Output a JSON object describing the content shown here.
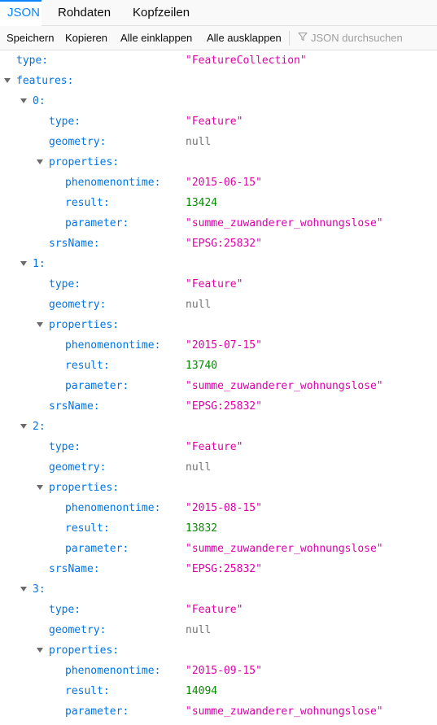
{
  "tabs": {
    "json": "JSON",
    "raw": "Rohdaten",
    "headers": "Kopfzeilen"
  },
  "toolbar": {
    "save": "Speichern",
    "copy": "Kopieren",
    "collapse_all": "Alle einklappen",
    "expand_all": "Alle ausklappen",
    "filter_placeholder": "JSON durchsuchen"
  },
  "colors": {
    "accent": "#0a84ff",
    "key": "#0074e8",
    "string": "#dd00a9",
    "number": "#058b00",
    "null": "#737373"
  },
  "icons": {
    "filter": "filter-icon",
    "expand": "chevron-down-icon"
  },
  "tree": [
    {
      "depth": 0,
      "key": "type:",
      "value": "\"FeatureCollection\"",
      "kind": "string",
      "expandable": false
    },
    {
      "depth": 0,
      "key": "features:",
      "value": "",
      "kind": "",
      "expandable": true
    },
    {
      "depth": 1,
      "key": "0:",
      "value": "",
      "kind": "",
      "expandable": true
    },
    {
      "depth": 2,
      "key": "type:",
      "value": "\"Feature\"",
      "kind": "string",
      "expandable": false
    },
    {
      "depth": 2,
      "key": "geometry:",
      "value": "null",
      "kind": "null",
      "expandable": false
    },
    {
      "depth": 2,
      "key": "properties:",
      "value": "",
      "kind": "",
      "expandable": true
    },
    {
      "depth": 3,
      "key": "phenomenontime:",
      "value": "\"2015-06-15\"",
      "kind": "string",
      "expandable": false
    },
    {
      "depth": 3,
      "key": "result:",
      "value": "13424",
      "kind": "number",
      "expandable": false
    },
    {
      "depth": 3,
      "key": "parameter:",
      "value": "\"summe_zuwanderer_wohnungslose\"",
      "kind": "string",
      "expandable": false
    },
    {
      "depth": 2,
      "key": "srsName:",
      "value": "\"EPSG:25832\"",
      "kind": "string",
      "expandable": false
    },
    {
      "depth": 1,
      "key": "1:",
      "value": "",
      "kind": "",
      "expandable": true
    },
    {
      "depth": 2,
      "key": "type:",
      "value": "\"Feature\"",
      "kind": "string",
      "expandable": false
    },
    {
      "depth": 2,
      "key": "geometry:",
      "value": "null",
      "kind": "null",
      "expandable": false
    },
    {
      "depth": 2,
      "key": "properties:",
      "value": "",
      "kind": "",
      "expandable": true
    },
    {
      "depth": 3,
      "key": "phenomenontime:",
      "value": "\"2015-07-15\"",
      "kind": "string",
      "expandable": false
    },
    {
      "depth": 3,
      "key": "result:",
      "value": "13740",
      "kind": "number",
      "expandable": false
    },
    {
      "depth": 3,
      "key": "parameter:",
      "value": "\"summe_zuwanderer_wohnungslose\"",
      "kind": "string",
      "expandable": false
    },
    {
      "depth": 2,
      "key": "srsName:",
      "value": "\"EPSG:25832\"",
      "kind": "string",
      "expandable": false
    },
    {
      "depth": 1,
      "key": "2:",
      "value": "",
      "kind": "",
      "expandable": true
    },
    {
      "depth": 2,
      "key": "type:",
      "value": "\"Feature\"",
      "kind": "string",
      "expandable": false
    },
    {
      "depth": 2,
      "key": "geometry:",
      "value": "null",
      "kind": "null",
      "expandable": false
    },
    {
      "depth": 2,
      "key": "properties:",
      "value": "",
      "kind": "",
      "expandable": true
    },
    {
      "depth": 3,
      "key": "phenomenontime:",
      "value": "\"2015-08-15\"",
      "kind": "string",
      "expandable": false
    },
    {
      "depth": 3,
      "key": "result:",
      "value": "13832",
      "kind": "number",
      "expandable": false
    },
    {
      "depth": 3,
      "key": "parameter:",
      "value": "\"summe_zuwanderer_wohnungslose\"",
      "kind": "string",
      "expandable": false
    },
    {
      "depth": 2,
      "key": "srsName:",
      "value": "\"EPSG:25832\"",
      "kind": "string",
      "expandable": false
    },
    {
      "depth": 1,
      "key": "3:",
      "value": "",
      "kind": "",
      "expandable": true
    },
    {
      "depth": 2,
      "key": "type:",
      "value": "\"Feature\"",
      "kind": "string",
      "expandable": false
    },
    {
      "depth": 2,
      "key": "geometry:",
      "value": "null",
      "kind": "null",
      "expandable": false
    },
    {
      "depth": 2,
      "key": "properties:",
      "value": "",
      "kind": "",
      "expandable": true
    },
    {
      "depth": 3,
      "key": "phenomenontime:",
      "value": "\"2015-09-15\"",
      "kind": "string",
      "expandable": false
    },
    {
      "depth": 3,
      "key": "result:",
      "value": "14094",
      "kind": "number",
      "expandable": false
    },
    {
      "depth": 3,
      "key": "parameter:",
      "value": "\"summe_zuwanderer_wohnungslose\"",
      "kind": "string",
      "expandable": false
    }
  ]
}
